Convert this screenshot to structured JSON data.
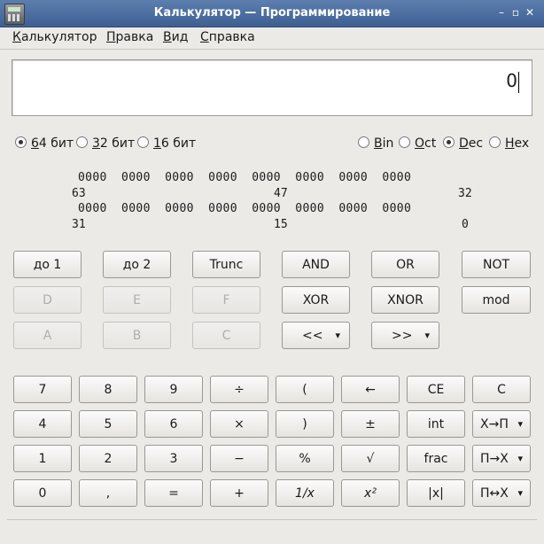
{
  "window": {
    "title": "Калькулятор — Программирование"
  },
  "menu": [
    {
      "first": "К",
      "rest": "алькулятор"
    },
    {
      "first": "П",
      "rest": "равка"
    },
    {
      "first": "В",
      "rest": "ид"
    },
    {
      "first": "С",
      "rest": "правка"
    }
  ],
  "display": {
    "value": "0"
  },
  "word_size": [
    {
      "first": "6",
      "rest": "4 бит",
      "selected": true
    },
    {
      "first": "3",
      "rest": "2 бит",
      "selected": false
    },
    {
      "first": "1",
      "rest": "6 бит",
      "selected": false
    }
  ],
  "base": [
    {
      "first": "B",
      "rest": "in",
      "selected": false
    },
    {
      "first": "O",
      "rest": "ct",
      "selected": false
    },
    {
      "first": "D",
      "rest": "ec",
      "selected": true
    },
    {
      "first": "H",
      "rest": "ex",
      "selected": false
    }
  ],
  "bits": {
    "row1": "0000  0000  0000  0000  0000  0000  0000  0000",
    "row2": "0000  0000  0000  0000  0000  0000  0000  0000",
    "label63": "63",
    "label47": "47",
    "label32": "32",
    "label31": "31",
    "label15": "15",
    "label0": "0"
  },
  "prog_buttons": {
    "to1": "до 1",
    "to2": "до 2",
    "trunc": "Trunc",
    "and": "AND",
    "or": "OR",
    "not": "NOT",
    "d": "D",
    "e": "E",
    "f": "F",
    "xor": "XOR",
    "xnor": "XNOR",
    "mod": "mod",
    "a": "A",
    "b": "B",
    "c": "C",
    "shl": "<<",
    "shr": ">>"
  },
  "keypad": {
    "k7": "7",
    "k8": "8",
    "k9": "9",
    "div": "÷",
    "lparen": "(",
    "back": "←",
    "ce": "CE",
    "clear": "C",
    "k4": "4",
    "k5": "5",
    "k6": "6",
    "mul": "×",
    "rparen": ")",
    "pm": "±",
    "int": "int",
    "x_to_mem": "X→П",
    "k1": "1",
    "k2": "2",
    "k3": "3",
    "minus": "−",
    "pct": "%",
    "sqrt": "√",
    "frac": "frac",
    "mem_to_x": "П→X",
    "k0": "0",
    "comma": ",",
    "eq": "=",
    "plus": "+",
    "inv": "1/x",
    "sq": "x²",
    "abs": "|x|",
    "swap": "П↔X"
  }
}
